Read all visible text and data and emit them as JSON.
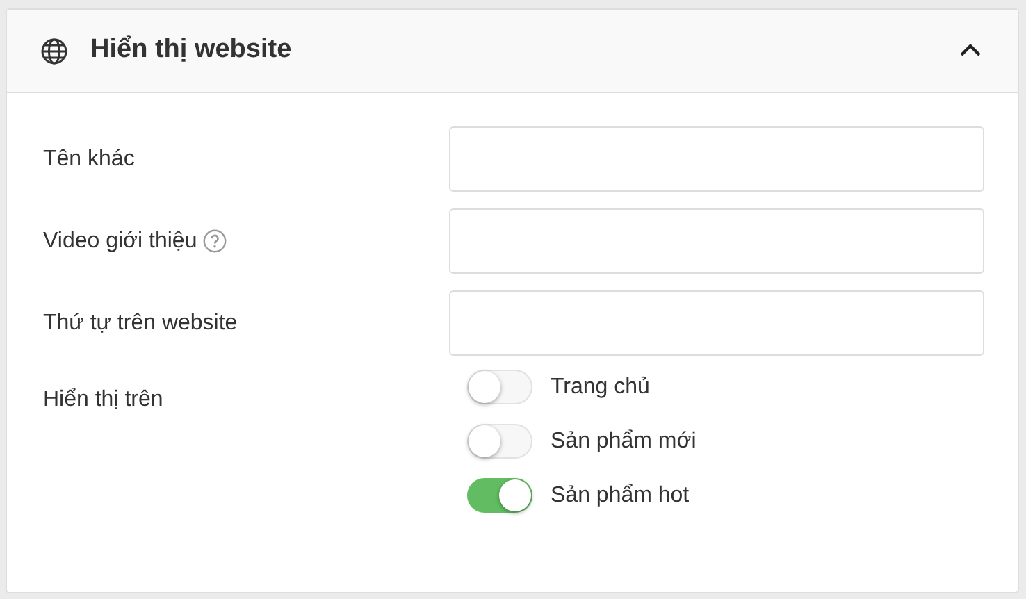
{
  "panel": {
    "title": "Hiển thị website",
    "expanded": true
  },
  "fields": [
    {
      "label": "Tên khác",
      "help": false
    },
    {
      "label": "Video giới thiệu",
      "help": true
    },
    {
      "label": "Thứ tự trên website",
      "help": false
    }
  ],
  "display_on": {
    "label": "Hiển thị trên",
    "options": [
      {
        "label": "Trang chủ",
        "on": false
      },
      {
        "label": "Sản phẩm mới",
        "on": false
      },
      {
        "label": "Sản phẩm hot",
        "on": true
      }
    ]
  }
}
